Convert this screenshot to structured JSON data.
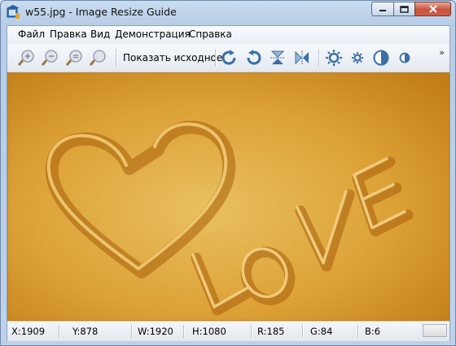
{
  "window": {
    "title": "w55.jpg - Image Resize Guide"
  },
  "menu": {
    "items": [
      "Файл",
      "Правка",
      "Вид",
      "Демонстрация",
      "Справка"
    ]
  },
  "toolbar": {
    "show_original_label": "Показать исходное",
    "overflow_label": "»",
    "icons": [
      "zoom-in-icon",
      "zoom-out-icon",
      "zoom-fit-icon",
      "zoom-actual-icon",
      "rotate-right-icon",
      "rotate-left-icon",
      "flip-vertical-icon",
      "flip-horizontal-icon",
      "brightness-up-icon",
      "brightness-down-icon",
      "contrast-up-icon",
      "contrast-down-icon"
    ]
  },
  "image": {
    "filename": "w55.jpg",
    "description_text": "LOVE"
  },
  "status": {
    "x": "X:1909",
    "y": "Y:878",
    "w": "W:1920",
    "h": "H:1080",
    "r": "R:185",
    "g": "G:84",
    "b": "B:6"
  },
  "colors": {
    "sand_light": "#f3c25a",
    "sand_dark": "#c77d12",
    "accent_blue": "#3a6ea5"
  }
}
